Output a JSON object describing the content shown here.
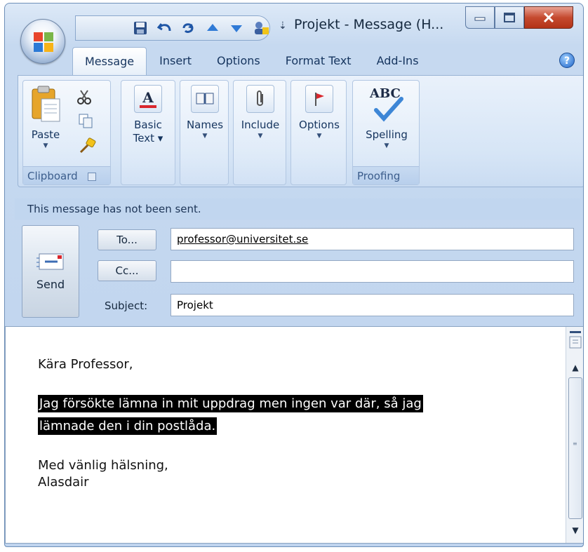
{
  "window": {
    "title": "Projekt - Message (H...",
    "minimize_icon": "minimize-icon",
    "maximize_icon": "maximize-icon",
    "close_icon": "close-icon"
  },
  "quick_access": {
    "items": [
      "save-icon",
      "undo-icon",
      "redo-icon",
      "previous-item-icon",
      "next-item-icon",
      "address-book-icon"
    ],
    "customize_icon": "customize-quick-access-icon",
    "customize_glyph": "⇣"
  },
  "tabs": [
    {
      "label": "Message",
      "active": true
    },
    {
      "label": "Insert",
      "active": false
    },
    {
      "label": "Options",
      "active": false
    },
    {
      "label": "Format Text",
      "active": false
    },
    {
      "label": "Add-Ins",
      "active": false
    }
  ],
  "help": {
    "glyph": "?"
  },
  "ribbon": {
    "clipboard": {
      "caption": "Clipboard",
      "paste_label": "Paste",
      "launcher_icon": "dialog-launcher-icon"
    },
    "basic_text": {
      "label_line1": "Basic",
      "label_line2": "Text ▾"
    },
    "names": {
      "label": "Names"
    },
    "include": {
      "label": "Include"
    },
    "options": {
      "label": "Options"
    },
    "proofing": {
      "caption": "Proofing",
      "spelling_label": "Spelling",
      "abc": "ABC"
    }
  },
  "info_bar": {
    "text": "This message has not been sent."
  },
  "compose": {
    "send_label": "Send",
    "to_button": "To...",
    "cc_button": "Cc...",
    "subject_label": "Subject:",
    "to_value": "professor@universitet.se",
    "cc_value": "",
    "subject_value": "Projekt"
  },
  "message": {
    "greeting": "Kära Professor,",
    "para_line1": "Jag försökte lämna in mit uppdrag men ingen var där, så jag",
    "para_line2": "lämnade den i din postlåda.",
    "closing": "Med vänlig hälsning,",
    "signature": "Alasdair"
  },
  "colors": {
    "accent": "#15345e",
    "close_button": "#c54a2f",
    "info_bar": "#c1d6ef",
    "selection": "#000000"
  }
}
